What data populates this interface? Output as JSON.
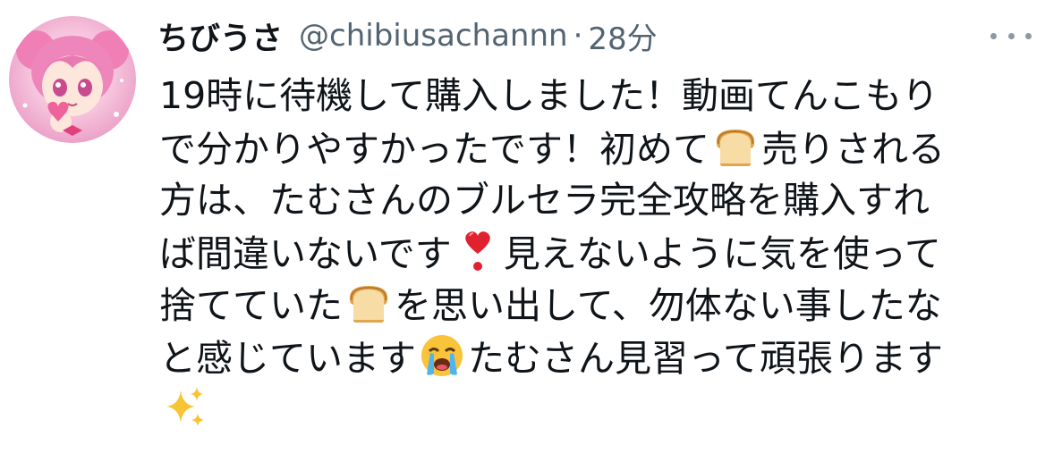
{
  "tweet": {
    "display_name": "ちびうさ",
    "handle": "@chibiusachannn",
    "separator": "·",
    "time": "28分",
    "lines": [
      [
        "19時に待機して購入しました！動画てんこもり"
      ],
      [
        "で分かりやすかったです！初めて",
        "bread-emoji",
        "売りされる"
      ],
      [
        "方は、たむさんのブルセラ完全攻略を購入すれ"
      ],
      [
        "ば間違いないです",
        "heart-emoji",
        "見えないように気を使って"
      ],
      [
        "捨てていた",
        "bread-emoji",
        "を思い出して、勿体ない事したな"
      ],
      [
        "と感じています",
        "crying-emoji",
        "たむさん見習って頑張ります"
      ],
      [
        "sparkles-emoji"
      ]
    ]
  },
  "colors": {
    "text": "#0f1419",
    "secondary": "#536471",
    "more_dots": "#8b98a5",
    "heart": "#e0222f",
    "bread": "#e2a44c",
    "avatar_pink": "#f6c3dc"
  },
  "icons": {
    "more": "more-dots-icon",
    "avatar": "avatar-anime-girl"
  }
}
